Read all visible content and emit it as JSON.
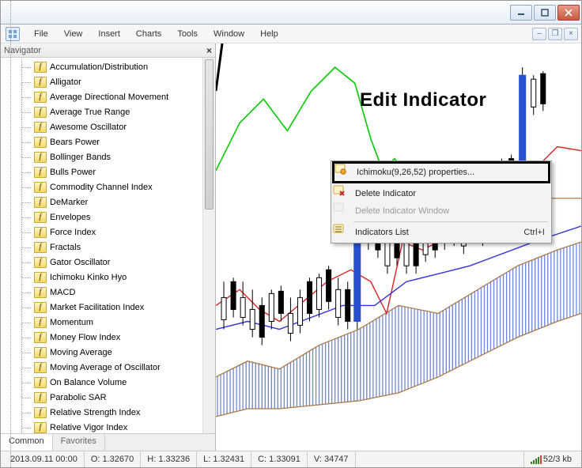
{
  "menubar": [
    "File",
    "View",
    "Insert",
    "Charts",
    "Tools",
    "Window",
    "Help"
  ],
  "navigator": {
    "title": "Navigator",
    "items": [
      "Accumulation/Distribution",
      "Alligator",
      "Average Directional Movement",
      "Average True Range",
      "Awesome Oscillator",
      "Bears Power",
      "Bollinger Bands",
      "Bulls Power",
      "Commodity Channel Index",
      "DeMarker",
      "Envelopes",
      "Force Index",
      "Fractals",
      "Gator Oscillator",
      "Ichimoku Kinko Hyo",
      "MACD",
      "Market Facilitation Index",
      "Momentum",
      "Money Flow Index",
      "Moving Average",
      "Moving Average of Oscillator",
      "On Balance Volume",
      "Parabolic SAR",
      "Relative Strength Index",
      "Relative Vigor Index"
    ],
    "tabs": {
      "common": "Common",
      "favorites": "Favorites"
    }
  },
  "context_menu": {
    "properties": "Ichimoku(9,26,52) properties...",
    "delete": "Delete Indicator",
    "delete_window": "Delete Indicator Window",
    "list": "Indicators List",
    "list_shortcut": "Ctrl+I"
  },
  "annotation": "Edit Indicator",
  "statusbar": {
    "datetime": "2013.09.11 00:00",
    "open": "O: 1.32670",
    "high": "H: 1.33236",
    "low": "L: 1.32431",
    "close": "C: 1.33091",
    "volume": "V: 34747",
    "conn": "52/3 kb"
  },
  "chart_data": {
    "type": "candlestick",
    "title": "",
    "indicators": [
      "Ichimoku Kinko Hyo (9,26,52)"
    ],
    "x_range_bars": 60,
    "y_range": [
      1.3,
      1.34
    ],
    "series": [
      {
        "name": "Tenkan-sen",
        "color": "#d22",
        "style": "line"
      },
      {
        "name": "Kijun-sen",
        "color": "#33d",
        "style": "line"
      },
      {
        "name": "Chikou Span",
        "color": "#0c0",
        "style": "line"
      },
      {
        "name": "Senkou Span A",
        "color": "#b08040",
        "style": "line"
      },
      {
        "name": "Senkou Span B",
        "color": "#b08040",
        "style": "line"
      },
      {
        "name": "Kumo Cloud",
        "color": "#2a4fd0",
        "style": "hatched-area"
      }
    ],
    "candles_sample": [
      {
        "o": 1.308,
        "h": 1.312,
        "l": 1.304,
        "c": 1.306,
        "dir": "down"
      },
      {
        "o": 1.306,
        "h": 1.31,
        "l": 1.303,
        "c": 1.309,
        "dir": "up"
      },
      {
        "o": 1.309,
        "h": 1.315,
        "l": 1.307,
        "c": 1.305,
        "dir": "down"
      },
      {
        "o": 1.305,
        "h": 1.308,
        "l": 1.3,
        "c": 1.302,
        "dir": "down"
      },
      {
        "o": 1.302,
        "h": 1.318,
        "l": 1.301,
        "c": 1.316,
        "dir": "up"
      },
      {
        "o": 1.316,
        "h": 1.322,
        "l": 1.313,
        "c": 1.32,
        "dir": "up"
      },
      {
        "o": 1.32,
        "h": 1.333,
        "l": 1.318,
        "c": 1.331,
        "dir": "up"
      },
      {
        "o": 1.3267,
        "h": 1.33236,
        "l": 1.32431,
        "c": 1.33091,
        "dir": "up"
      }
    ]
  }
}
